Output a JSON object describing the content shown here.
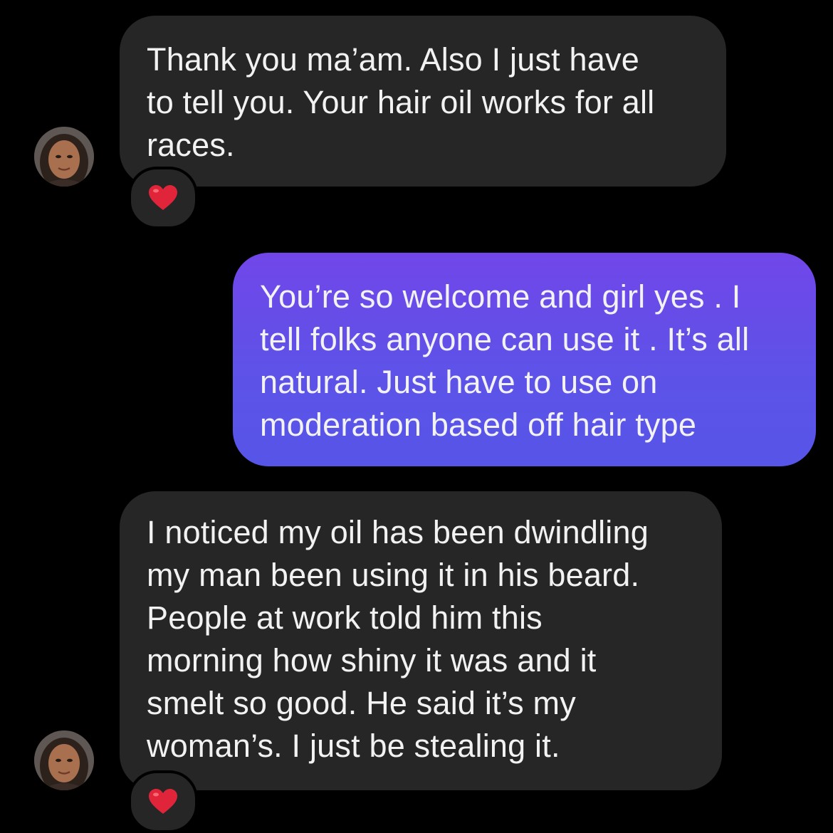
{
  "conversation": {
    "messages": [
      {
        "direction": "incoming",
        "lines": [
          "Thank you ma’am. Also I just have",
          "to tell you. Your hair oil works for all",
          "races."
        ],
        "reaction": "heart-emoji"
      },
      {
        "direction": "outgoing",
        "lines": [
          "You’re so welcome and girl yes . I",
          "tell folks anyone can use it . It’s all",
          "natural. Just have to use on",
          "moderation based off hair type"
        ]
      },
      {
        "direction": "incoming",
        "lines": [
          "I noticed my oil has been dwindling",
          "my man been using it in his beard.",
          "People at work told him this",
          "morning how shiny it was and it",
          "smelt so good. He said it’s my",
          "woman’s. I just be stealing it."
        ],
        "reaction": "heart-emoji"
      }
    ]
  },
  "colors": {
    "background": "#000000",
    "incoming_bubble": "#262626",
    "outgoing_bubble_top": "#7146e9",
    "outgoing_bubble_bottom": "#5655e7",
    "text": "#f2f2f2",
    "heart": "#e0243a"
  }
}
